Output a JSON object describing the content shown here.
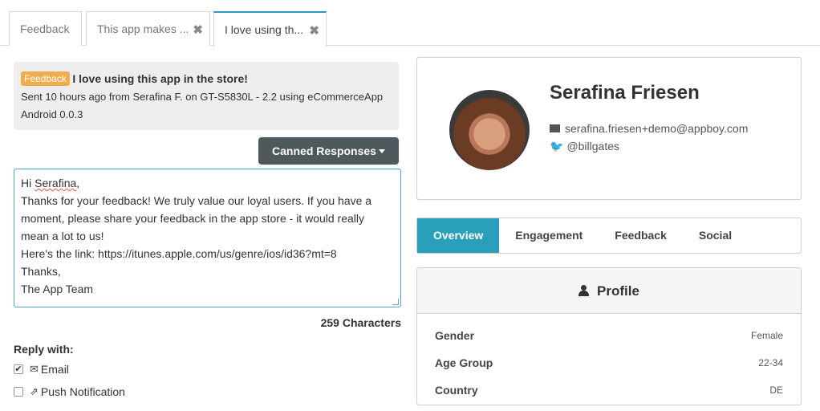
{
  "tabs": [
    {
      "label": "Feedback",
      "closable": false
    },
    {
      "label": "This app makes ...",
      "closable": true
    },
    {
      "label": "I love using th...",
      "closable": true,
      "active": true
    }
  ],
  "feedback": {
    "badge": "Feedback",
    "title": "I love using this app in the store!",
    "meta_line1": "Sent 10 hours ago from Serafina F. on GT-S5830L - 2.2 using eCommerceApp",
    "meta_line2": "Android 0.0.3"
  },
  "canned_button": "Canned Responses",
  "reply": {
    "greeting_prefix": "Hi ",
    "greeting_name": "Serafina",
    "greeting_suffix": ",",
    "lines": [
      "Thanks for your feedback! We truly value our loyal users. If you have a",
      "moment, please share your feedback in the app store - it would really",
      "mean a lot to us!",
      "Here's the link: https://itunes.apple.com/us/genre/ios/id36?mt=8",
      "Thanks,",
      "The App Team"
    ],
    "char_count": "259 Characters"
  },
  "reply_with": {
    "label": "Reply with:",
    "options": [
      {
        "label": "Email",
        "checked": true,
        "icon": "envelope-icon"
      },
      {
        "label": "Push Notification",
        "checked": false,
        "icon": "share-icon"
      }
    ]
  },
  "user": {
    "name": "Serafina Friesen",
    "email": "serafina.friesen+demo@appboy.com",
    "twitter": "@billgates"
  },
  "nav_tabs": [
    "Overview",
    "Engagement",
    "Feedback",
    "Social"
  ],
  "profile": {
    "heading": "Profile",
    "rows": [
      {
        "label": "Gender",
        "value": "Female"
      },
      {
        "label": "Age Group",
        "value": "22-34"
      },
      {
        "label": "Country",
        "value": "DE"
      }
    ]
  },
  "colors": {
    "accent": "#2a9fbc",
    "badge": "#f0ad4e",
    "button": "#4f585d"
  }
}
